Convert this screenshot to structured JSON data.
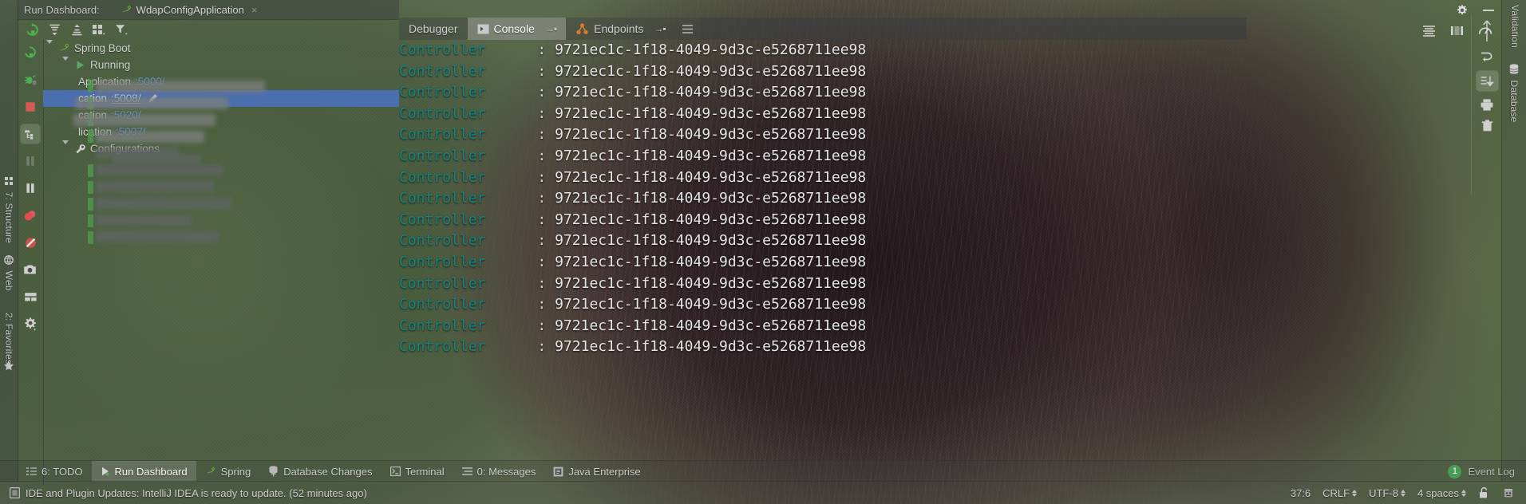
{
  "window": {
    "title": "Run Dashboard:",
    "tab_label": "WdapConfigApplication",
    "tab_close": "×",
    "settings_icon": "gear-icon",
    "minimize_icon": "minimize-icon"
  },
  "dashboard": {
    "toolbar": [
      {
        "name": "rerun-icon",
        "label": "Rerun"
      },
      {
        "name": "expand-all-icon",
        "label": "Expand All"
      },
      {
        "name": "collapse-all-icon",
        "label": "Collapse All"
      },
      {
        "name": "group-by-icon",
        "label": "Group By"
      },
      {
        "name": "filter-icon",
        "label": "Filter"
      }
    ],
    "side_toolbar": [
      {
        "name": "rerun-icon",
        "label": "Rerun"
      },
      {
        "name": "debug-icon",
        "label": "Debug"
      },
      {
        "name": "stop-icon",
        "label": "Stop"
      },
      {
        "name": "show-tree-icon",
        "label": "Show Run Configurations",
        "selected": true
      },
      {
        "name": "step-icon",
        "label": "Step"
      },
      {
        "name": "pause-icon",
        "label": "Pause Program"
      },
      {
        "name": "breakpoints-icon",
        "label": "View Breakpoints"
      },
      {
        "name": "mute-breakpoints-icon",
        "label": "Mute Breakpoints"
      },
      {
        "name": "camera-icon",
        "label": "Export Thread Dump"
      },
      {
        "name": "layout-icon",
        "label": "Layout Settings"
      },
      {
        "name": "settings-icon",
        "label": "Settings"
      }
    ],
    "tree": [
      {
        "level": 0,
        "expanded": true,
        "icon": "spring-boot-icon",
        "label": "Spring Boot",
        "port": "",
        "redacted": false
      },
      {
        "level": 1,
        "expanded": true,
        "icon": "run-icon",
        "label": "Running",
        "port": "",
        "redacted": false
      },
      {
        "level": 2,
        "expanded": false,
        "icon": "app-icon",
        "label": "Application",
        "port": ":5000/",
        "redacted": true,
        "selected": false
      },
      {
        "level": 2,
        "expanded": false,
        "icon": "app-icon",
        "label": "cation",
        "port": ":5008/",
        "redacted": true,
        "selected": true
      },
      {
        "level": 2,
        "expanded": false,
        "icon": "app-icon",
        "label": "cation",
        "port": ":5020/",
        "redacted": true,
        "selected": false
      },
      {
        "level": 2,
        "expanded": false,
        "icon": "app-icon",
        "label": "lication",
        "port": ":5007/",
        "redacted": true,
        "selected": false
      },
      {
        "level": 1,
        "expanded": true,
        "icon": "wrench-icon",
        "label": "Configurations",
        "port": "",
        "redacted": true,
        "selected": false
      },
      {
        "level": 2,
        "expanded": false,
        "icon": "app-icon",
        "label": "",
        "port": "",
        "redacted": true,
        "selected": false
      },
      {
        "level": 2,
        "expanded": false,
        "icon": "app-icon",
        "label": "",
        "port": "",
        "redacted": true,
        "selected": false
      },
      {
        "level": 2,
        "expanded": false,
        "icon": "app-icon",
        "label": "",
        "port": "",
        "redacted": true,
        "selected": false
      },
      {
        "level": 2,
        "expanded": false,
        "icon": "app-icon",
        "label": "",
        "port": "",
        "redacted": true,
        "selected": false
      },
      {
        "level": 2,
        "expanded": false,
        "icon": "app-icon",
        "label": "",
        "port": "",
        "redacted": true,
        "selected": false
      }
    ]
  },
  "console": {
    "tabs": [
      {
        "label": "Debugger",
        "icon": "",
        "active": false,
        "pin": ""
      },
      {
        "label": "Console",
        "icon": "console-icon",
        "active": true,
        "pin": "→▪"
      },
      {
        "label": "Endpoints",
        "icon": "endpoints-icon",
        "active": false,
        "pin": "→▪"
      }
    ],
    "log_class": "Controller",
    "log_separator": ":",
    "log_uuid": "9721ec1c-1f18-4049-9d3c-e5268711ee98",
    "log_line_count": 15,
    "colors": {
      "class": "#14857f",
      "text": "#e6e6e6",
      "selection": "#4b6eaf",
      "link": "#5f9be0",
      "badge_green": "#499c54"
    }
  },
  "top_right_icons": [
    {
      "name": "soft-wrap-icon"
    },
    {
      "name": "print-preview-icon"
    },
    {
      "name": "gauge-icon"
    }
  ],
  "left_strip": [
    {
      "label": "7: Structure",
      "underline": "7",
      "icon": "structure-icon"
    },
    {
      "label": "Web",
      "underline": "",
      "icon": "web-icon"
    },
    {
      "label": "2: Favorites",
      "underline": "2",
      "icon": "favorites-icon"
    }
  ],
  "right_strip": [
    {
      "label": "Validation",
      "icon": "validation-icon"
    },
    {
      "label": "Database",
      "icon": "database-icon"
    }
  ],
  "right_vtool": [
    {
      "name": "up-arrow-icon"
    },
    {
      "name": "rollback-icon"
    },
    {
      "name": "commit-icon",
      "selected": true
    },
    {
      "name": "print-icon"
    },
    {
      "name": "delete-icon"
    }
  ],
  "bottom_tabs": [
    {
      "label": "6: TODO",
      "underline": "6",
      "icon": "todo-icon",
      "active": false
    },
    {
      "label": "Run Dashboard",
      "underline": "",
      "icon": "run-icon",
      "active": true
    },
    {
      "label": "Spring",
      "underline": "",
      "icon": "spring-icon",
      "active": false
    },
    {
      "label": "Database Changes",
      "underline": "",
      "icon": "database-changes-icon",
      "active": false
    },
    {
      "label": "Terminal",
      "underline": "",
      "icon": "terminal-icon",
      "active": false
    },
    {
      "label": "0: Messages",
      "underline": "0",
      "icon": "messages-icon",
      "active": false
    },
    {
      "label": "Java Enterprise",
      "underline": "",
      "icon": "java-enterprise-icon",
      "active": false
    }
  ],
  "event_log": {
    "count": "1",
    "label": "Event Log"
  },
  "status_bar": {
    "message": "IDE and Plugin Updates: IntelliJ IDEA is ready to update. (52 minutes ago)",
    "message_icon": "notification-icon",
    "caret": "37:6",
    "line_separator": "CRLF",
    "encoding": "UTF-8",
    "indent": "4 spaces",
    "lock_icon": "unlock-icon",
    "inspector_icon": "hector-icon"
  }
}
